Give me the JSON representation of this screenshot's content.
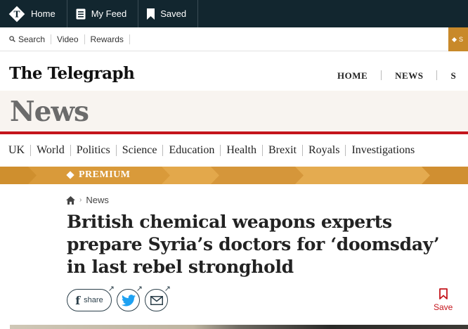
{
  "topbar": {
    "items": [
      {
        "label": "Home",
        "icon": "telegraph-t-logo-icon"
      },
      {
        "label": "My Feed",
        "icon": "feed-icon"
      },
      {
        "label": "Saved",
        "icon": "bookmark-icon"
      }
    ]
  },
  "utility": {
    "search": "Search",
    "video": "Video",
    "rewards": "Rewards",
    "subscribe_initial": "S"
  },
  "masthead": {
    "logo": "The Telegraph",
    "nav": [
      "HOME",
      "NEWS",
      "S"
    ]
  },
  "section": {
    "title": "News"
  },
  "section_nav": [
    "UK",
    "World",
    "Politics",
    "Science",
    "Education",
    "Health",
    "Brexit",
    "Royals",
    "Investigations"
  ],
  "premium": {
    "label": "PREMIUM"
  },
  "breadcrumb": {
    "home_icon": "home-icon",
    "current": "News"
  },
  "article": {
    "headline_lines": [
      "British chemical weapons experts",
      "prepare Syria’s doctors for ‘doomsday’",
      "in last rebel stronghold"
    ]
  },
  "share": {
    "facebook_label": "share",
    "save_label": "Save"
  },
  "colors": {
    "topbar": "#12262f",
    "accent_gold": "#d99a3a",
    "accent_red": "#c4151c",
    "banner_bg": "#f8f4f0"
  }
}
